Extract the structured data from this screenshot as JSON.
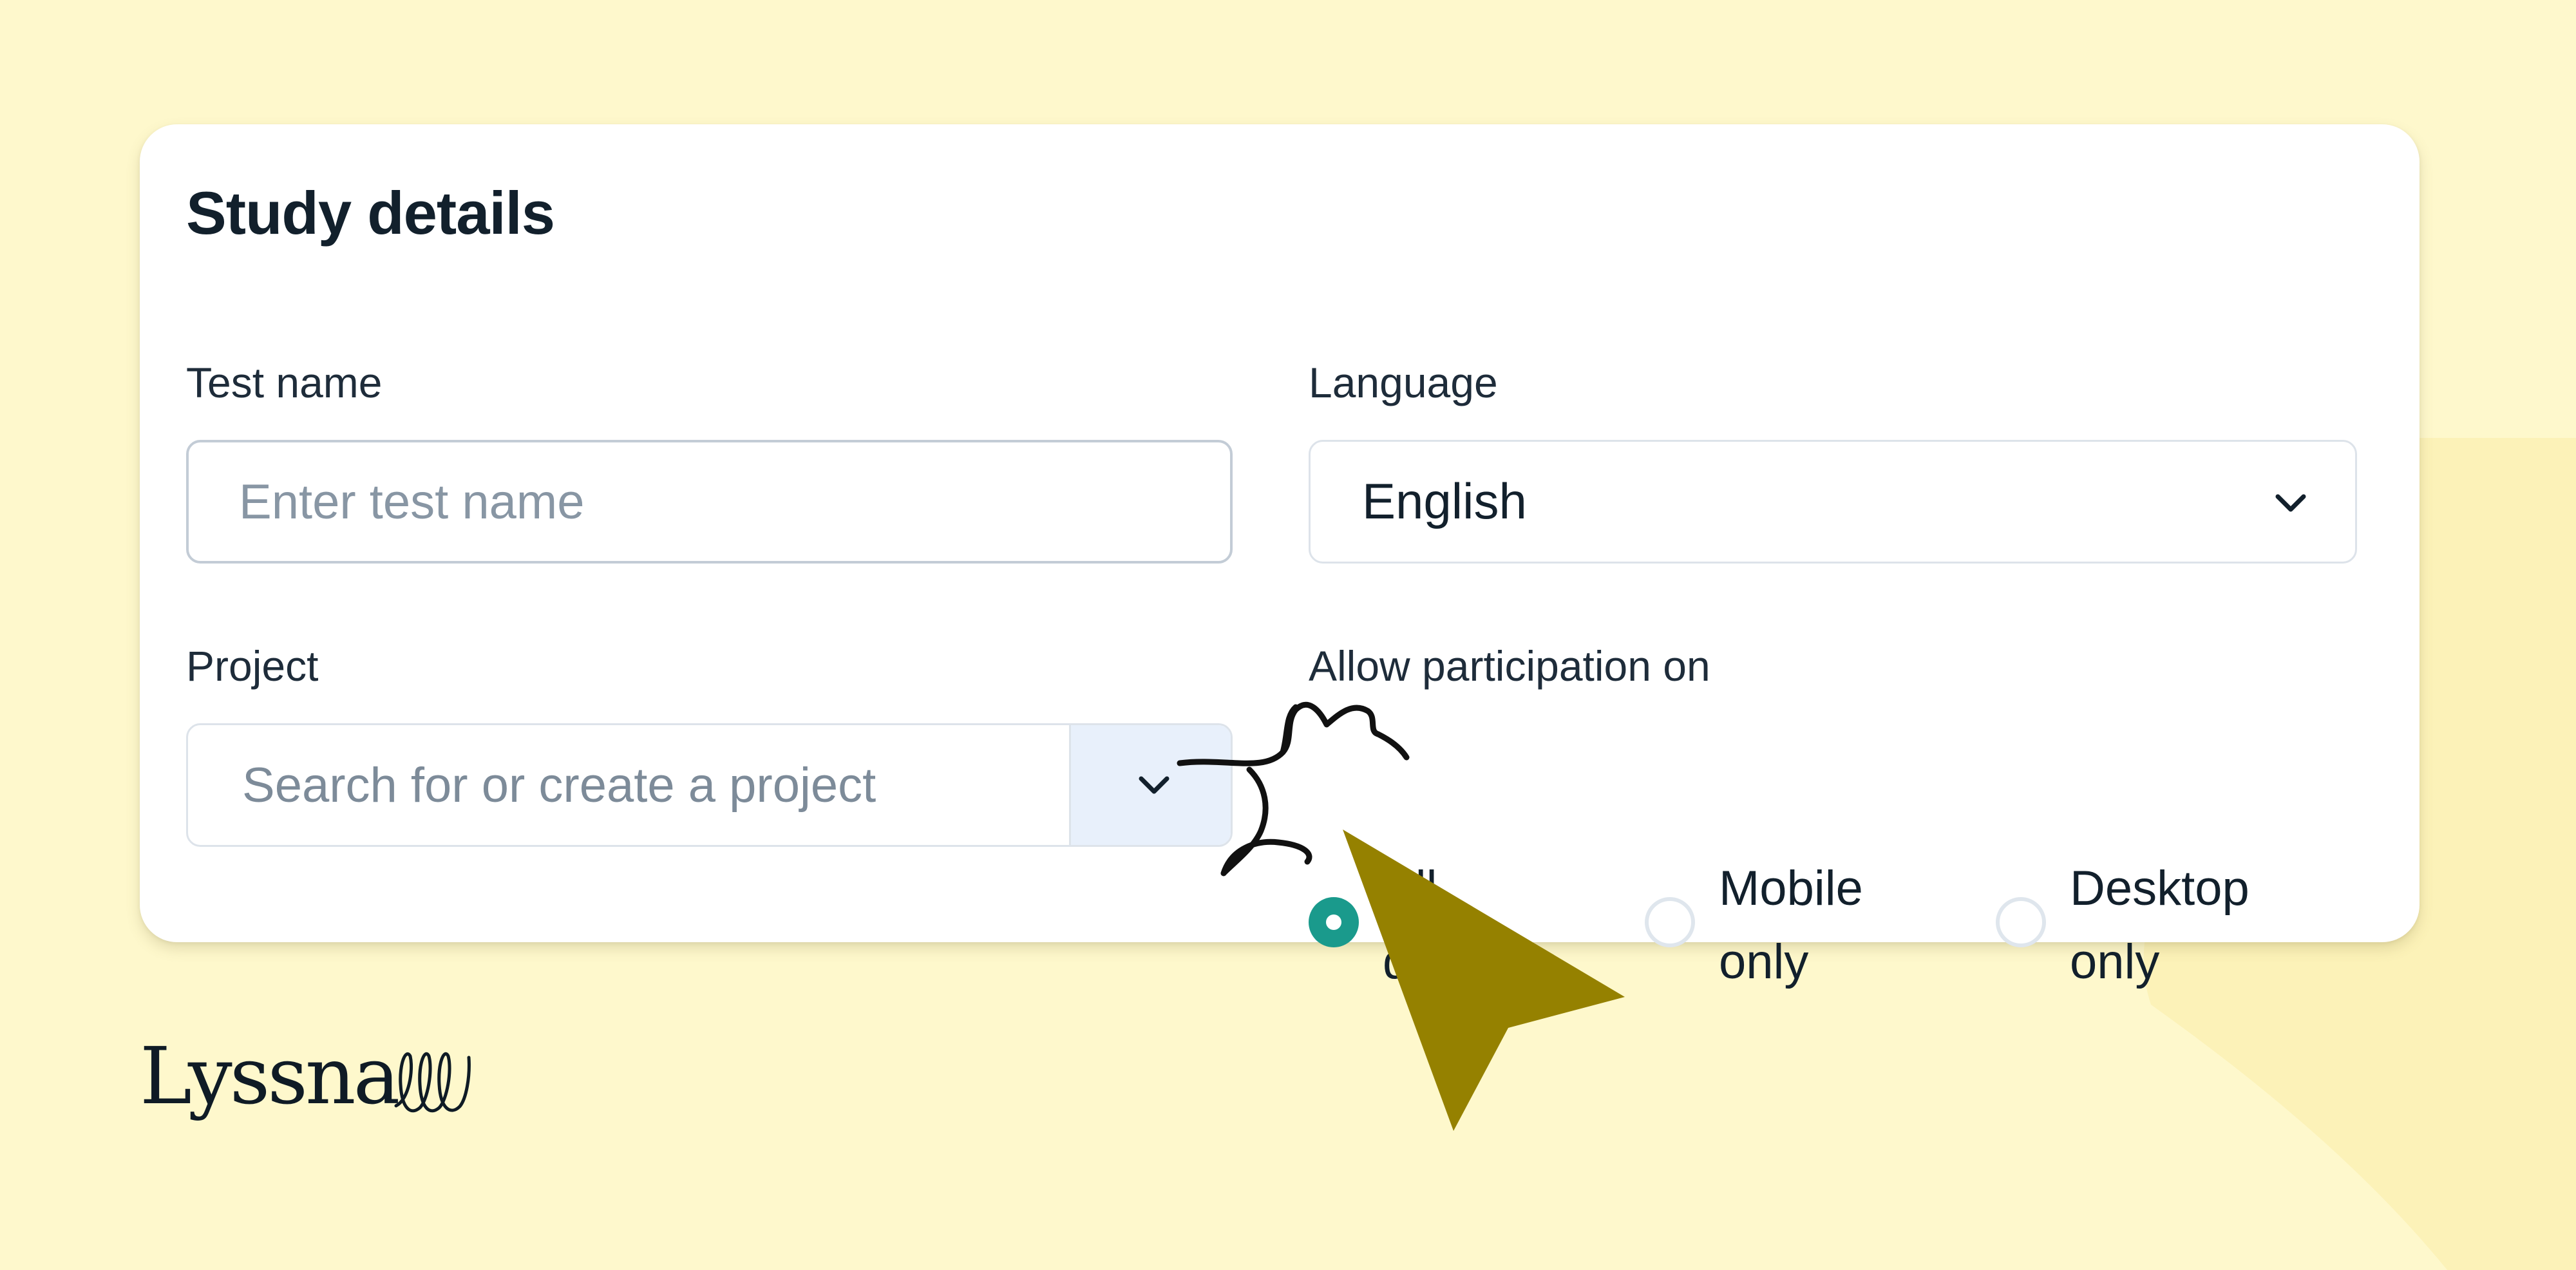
{
  "card": {
    "title": "Study details"
  },
  "fields": {
    "test_name": {
      "label": "Test name",
      "value": "",
      "placeholder": "Enter test name"
    },
    "language": {
      "label": "Language",
      "value": "English"
    },
    "project": {
      "label": "Project",
      "value": "",
      "placeholder": "Search for or create a project"
    },
    "participation": {
      "label": "Allow participation on",
      "options": [
        {
          "line1": "All",
          "line2": "devices",
          "selected": true
        },
        {
          "line1": "Mobile",
          "line2": "only",
          "selected": false
        },
        {
          "line1": "Desktop",
          "line2": "only",
          "selected": false
        }
      ]
    }
  },
  "brand": {
    "logo_text": "Lyssna"
  },
  "icons": {
    "language_dropdown": "chevron-down-icon",
    "project_dropdown": "chevron-down-icon",
    "cursor": "mouse-pointer-icon",
    "logo_mark": "loop-scribble-icon"
  },
  "colors": {
    "background": "#FEF8CC",
    "card": "#FFFFFF",
    "accent_radio": "#1A9A8C",
    "cursor": "#958100",
    "text": "#12202C"
  }
}
